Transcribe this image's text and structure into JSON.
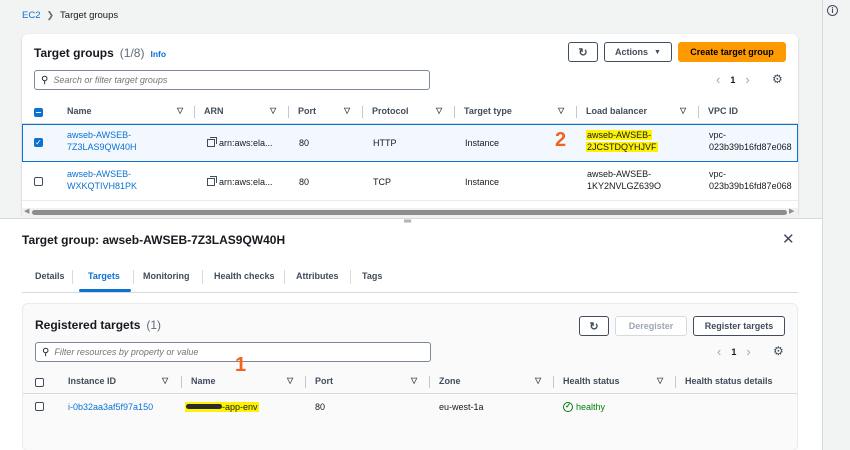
{
  "breadcrumb": {
    "ec2": "EC2",
    "current": "Target groups"
  },
  "target_groups": {
    "title": "Target groups",
    "count": "(1/8)",
    "info": "Info",
    "actions_label": "Actions",
    "create_label": "Create target group",
    "search_placeholder": "Search or filter target groups",
    "page": "1",
    "columns": [
      "Name",
      "ARN",
      "Port",
      "Protocol",
      "Target type",
      "Load balancer",
      "VPC ID"
    ],
    "rows": [
      {
        "name1": "awseb-AWSEB-",
        "name2": "7Z3LAS9QW40H",
        "arn": "arn:aws:ela...",
        "port": "80",
        "protocol": "HTTP",
        "target_type": "Instance",
        "lb1": "awseb-AWSEB-",
        "lb2": "2JCSTDQYHJVF",
        "vpc1": "vpc-",
        "vpc2": "023b39b16fd87e068",
        "selected": true
      },
      {
        "name1": "awseb-AWSEB-",
        "name2": "WXKQTIVH81PK",
        "arn": "arn:aws:ela...",
        "port": "80",
        "protocol": "TCP",
        "target_type": "Instance",
        "lb1": "awseb-AWSEB-",
        "lb2": "1KY2NVLGZ639O",
        "vpc1": "vpc-",
        "vpc2": "023b39b16fd87e068",
        "selected": false
      }
    ],
    "annotation": "2"
  },
  "detail": {
    "title": "Target group: awseb-AWSEB-7Z3LAS9QW40H",
    "tabs": [
      "Details",
      "Targets",
      "Monitoring",
      "Health checks",
      "Attributes",
      "Tags"
    ],
    "active_tab": "Targets"
  },
  "registered": {
    "title": "Registered targets",
    "count": "(1)",
    "deregister_label": "Deregister",
    "register_label": "Register targets",
    "search_placeholder": "Filter resources by property or value",
    "page": "1",
    "columns": [
      "Instance ID",
      "Name",
      "Port",
      "Zone",
      "Health status",
      "Health status details"
    ],
    "rows": [
      {
        "instance_id": "i-0b32aa3af5f97a150",
        "name": "-app-env",
        "port": "80",
        "zone": "eu-west-1a",
        "health": "healthy"
      }
    ],
    "annotation": "1"
  },
  "colors": {
    "link": "#0972d3",
    "primary": "#ff9900",
    "highlight": "#fff200",
    "annotation": "#f0651b",
    "healthy": "#037f0c"
  }
}
